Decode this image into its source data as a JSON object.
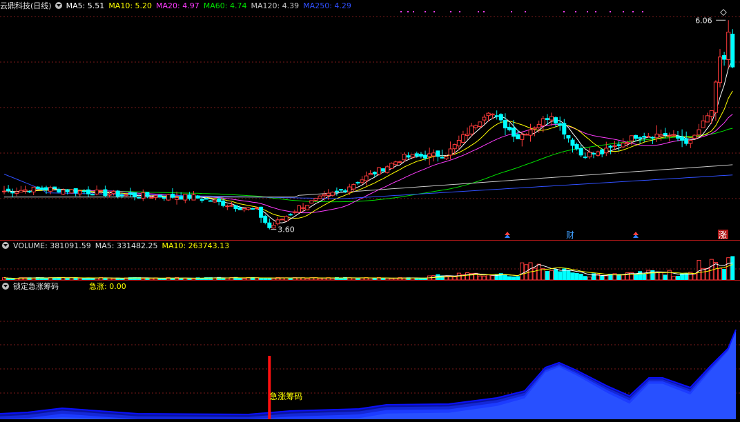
{
  "title": "云鼎科技(日线)",
  "ma_legend": [
    {
      "label": "MA5: 5.51",
      "color": "#ffffff"
    },
    {
      "label": "MA10: 5.20",
      "color": "#ffff00"
    },
    {
      "label": "MA20: 4.97",
      "color": "#ff3cff"
    },
    {
      "label": "MA60: 4.74",
      "color": "#00e000"
    },
    {
      "label": "MA120: 4.39",
      "color": "#c8c8c8"
    },
    {
      "label": "MA250: 4.29",
      "color": "#3050ff"
    }
  ],
  "volume_legend": [
    {
      "label": "VOLUME: 381091.59",
      "color": "#e0e0e0"
    },
    {
      "label": "MA5: 331482.25",
      "color": "#e0e0e0"
    },
    {
      "label": "MA10: 263743.13",
      "color": "#ffff00"
    }
  ],
  "indicator": {
    "name": "锁定急涨筹码",
    "value_label": "急涨: 0.00",
    "signal_label": "急涨筹码"
  },
  "annotations": {
    "high": "6.06",
    "low": "3.60"
  },
  "event_badges": [
    "财",
    "涨"
  ],
  "colors": {
    "up": "#ff3b3b",
    "down": "#00ffff",
    "ma5": "#ffffff",
    "ma10": "#ffff00",
    "ma20": "#ff3cff",
    "ma60": "#00e000",
    "ma120": "#c8c8c8",
    "ma250": "#3050ff",
    "grid": "#7a1a1a",
    "area": "#1020e0"
  },
  "chart_data": {
    "type": "candlestick",
    "title": "云鼎科技(日线)",
    "price_range": [
      3.5,
      6.2
    ],
    "high_label": 6.06,
    "low_label": 3.6,
    "days": 174,
    "key_points": [
      {
        "day": 0,
        "close": 4.05
      },
      {
        "day": 10,
        "close": 4.08
      },
      {
        "day": 30,
        "close": 4.0
      },
      {
        "day": 45,
        "close": 3.98
      },
      {
        "day": 60,
        "close": 3.82
      },
      {
        "day": 63,
        "close": 3.62
      },
      {
        "day": 70,
        "close": 3.86
      },
      {
        "day": 80,
        "close": 4.06
      },
      {
        "day": 95,
        "close": 4.45
      },
      {
        "day": 105,
        "close": 4.48
      },
      {
        "day": 115,
        "close": 5.0
      },
      {
        "day": 122,
        "close": 4.68
      },
      {
        "day": 130,
        "close": 4.95
      },
      {
        "day": 137,
        "close": 4.48
      },
      {
        "day": 142,
        "close": 4.5
      },
      {
        "day": 150,
        "close": 4.7
      },
      {
        "day": 157,
        "close": 4.72
      },
      {
        "day": 163,
        "close": 4.62
      },
      {
        "day": 168,
        "close": 5.0
      },
      {
        "day": 171,
        "close": 5.9
      },
      {
        "day": 173,
        "close": 5.51
      }
    ],
    "moving_averages": {
      "MA5": 5.51,
      "MA10": 5.2,
      "MA20": 4.97,
      "MA60": 4.74,
      "MA120": 4.39,
      "MA250": 4.29
    },
    "volume": {
      "VOLUME": 381091.59,
      "MA5": 331482.25,
      "MA10": 263743.13
    },
    "indicator": {
      "name": "锁定急涨筹码",
      "急涨": 0.0,
      "signal_day": 63
    }
  }
}
